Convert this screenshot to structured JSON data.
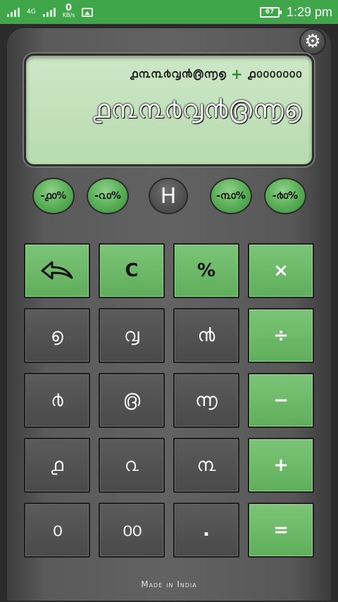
{
  "status_bar": {
    "network_type": "4G",
    "speed_value": "0",
    "speed_unit": "KB/s",
    "battery": "67",
    "time": "1:29 pm"
  },
  "display": {
    "expression_left": "൧൩൩൪൮൯൫൬൭",
    "operator": "+",
    "expression_right": "൧൦൦൦൦൦൦൦",
    "result": "൧൩൩൪൮൯൫൬൭"
  },
  "percent_buttons": [
    {
      "label": "-൧൦%"
    },
    {
      "label": "-൨൦%"
    },
    {
      "label": "H"
    },
    {
      "label": "-൩൦%"
    },
    {
      "label": "-൪൦%"
    }
  ],
  "keys": {
    "back": "⟲",
    "clear": "C",
    "percent": "%",
    "multiply": "×",
    "divide": "÷",
    "minus": "−",
    "plus": "+",
    "equals": "=",
    "seven": "൭",
    "eight": "൮",
    "nine": "൯",
    "four": "൪",
    "five": "൫",
    "six": "൬",
    "one": "൧",
    "two": "൨",
    "three": "൩",
    "zero": "൦",
    "double_zero": "൦൦",
    "dot": "."
  },
  "footer": "Made in India",
  "colors": {
    "status_bar": "#3fa64a",
    "accent_green": "#5fae5c",
    "display_bg": "#c6e3bd"
  }
}
